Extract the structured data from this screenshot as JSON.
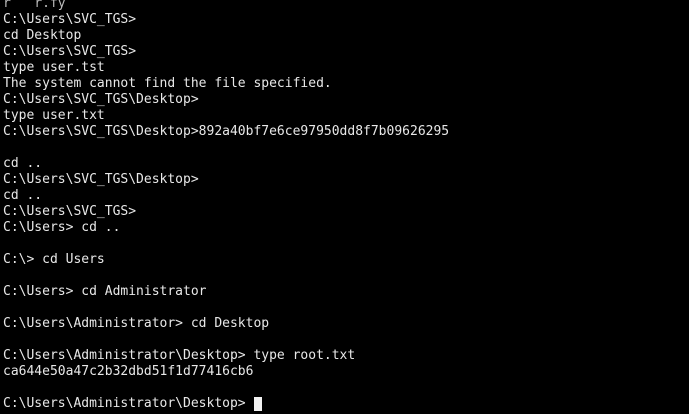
{
  "terminal": {
    "clipped_top": "r   r.fy",
    "lines": [
      "C:\\Users\\SVC_TGS>",
      "cd Desktop",
      "C:\\Users\\SVC_TGS>",
      "type user.tst",
      "The system cannot find the file specified.",
      "C:\\Users\\SVC_TGS\\Desktop>",
      "type user.txt",
      "C:\\Users\\SVC_TGS\\Desktop>892a40bf7e6ce97950dd8f7b09626295",
      "",
      "cd ..",
      "C:\\Users\\SVC_TGS\\Desktop>",
      "cd ..",
      "C:\\Users\\SVC_TGS>",
      "C:\\Users> cd ..",
      "",
      "C:\\> cd Users",
      "",
      "C:\\Users> cd Administrator",
      "",
      "C:\\Users\\Administrator> cd Desktop",
      "",
      "C:\\Users\\Administrator\\Desktop> type root.txt",
      "ca644e50a47c2b32dbd51f1d77416cb6",
      "",
      "C:\\Users\\Administrator\\Desktop>"
    ]
  }
}
